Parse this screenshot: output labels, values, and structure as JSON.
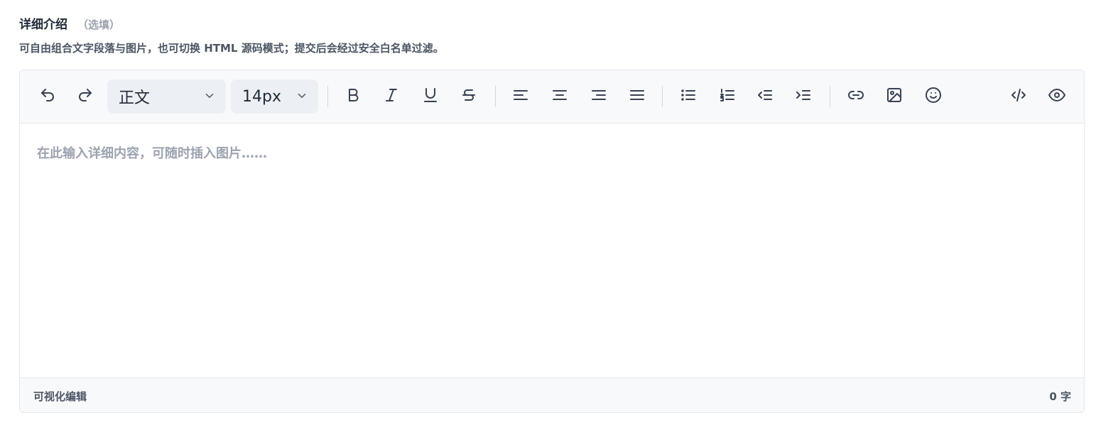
{
  "field": {
    "label": "详细介绍",
    "optional": "（选填）",
    "hint": "可自由组合文字段落与图片，也可切换 HTML 源码模式；提交后会经过安全白名单过滤。"
  },
  "toolbar": {
    "block_format": "正文",
    "font_size": "14px",
    "icons": [
      "undo-icon",
      "redo-icon",
      "bold-icon",
      "italic-icon",
      "underline-icon",
      "strikethrough-icon",
      "align-left-icon",
      "align-center-icon",
      "align-right-icon",
      "align-justify-icon",
      "bullet-list-icon",
      "numbered-list-icon",
      "outdent-icon",
      "indent-icon",
      "link-icon",
      "image-icon",
      "emoji-icon",
      "code-icon",
      "preview-icon"
    ]
  },
  "editor": {
    "placeholder": "在此输入详细内容，可随时插入图片……"
  },
  "footer": {
    "mode": "可视化编辑",
    "count": "0 字"
  }
}
